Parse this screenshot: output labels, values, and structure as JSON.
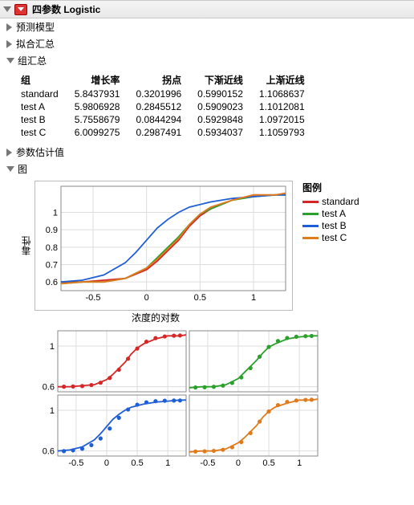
{
  "main_title": "四参数 Logistic",
  "sections": {
    "predict_model": "预测模型",
    "fit_summary": "拟合汇总",
    "group_summary": "组汇总",
    "param_est": "参数估计值",
    "chart": "图"
  },
  "table": {
    "headers": [
      "组",
      "增长率",
      "拐点",
      "下渐近线",
      "上渐近线"
    ],
    "rows": [
      [
        "standard",
        "5.8437931",
        "0.3201996",
        "0.5990152",
        "1.1068637"
      ],
      [
        "test A",
        "5.9806928",
        "0.2845512",
        "0.5909023",
        "1.1012081"
      ],
      [
        "test B",
        "5.7558679",
        "0.0844294",
        "0.5929848",
        "1.0972015"
      ],
      [
        "test C",
        "6.0099275",
        "0.2987491",
        "0.5934037",
        "1.1059793"
      ]
    ]
  },
  "legend_title": "图例",
  "series_colors": {
    "standard": "#d62728",
    "test A": "#2ca02c",
    "test B": "#1f5fd6",
    "test C": "#e07b1c"
  },
  "series_order": [
    "standard",
    "test A",
    "test B",
    "test C"
  ],
  "y_axis_label": "毒性",
  "x_axis_label": "浓度的对数",
  "chart_data": {
    "type": "line",
    "title": "",
    "xlabel": "浓度的对数",
    "ylabel": "毒性",
    "xlim": [
      -0.8,
      1.3
    ],
    "ylim": [
      0.55,
      1.15
    ],
    "xticks": [
      -0.5,
      0,
      0.5,
      1
    ],
    "yticks": [
      0.6,
      0.7,
      0.8,
      0.9,
      1
    ],
    "series": [
      {
        "name": "standard",
        "color": "#d62728",
        "x": [
          -0.8,
          -0.6,
          -0.4,
          -0.2,
          0.0,
          0.1,
          0.2,
          0.3,
          0.4,
          0.5,
          0.6,
          0.8,
          1.0,
          1.2,
          1.3
        ],
        "y": [
          0.6,
          0.6,
          0.61,
          0.62,
          0.67,
          0.72,
          0.78,
          0.84,
          0.92,
          0.98,
          1.02,
          1.07,
          1.1,
          1.1,
          1.11
        ]
      },
      {
        "name": "test A",
        "color": "#2ca02c",
        "x": [
          -0.8,
          -0.6,
          -0.4,
          -0.2,
          0.0,
          0.1,
          0.2,
          0.3,
          0.4,
          0.5,
          0.6,
          0.8,
          1.0,
          1.2,
          1.3
        ],
        "y": [
          0.59,
          0.6,
          0.6,
          0.62,
          0.68,
          0.74,
          0.8,
          0.86,
          0.93,
          0.99,
          1.02,
          1.07,
          1.09,
          1.1,
          1.1
        ]
      },
      {
        "name": "test B",
        "color": "#1f5fd6",
        "x": [
          -0.8,
          -0.6,
          -0.4,
          -0.2,
          -0.1,
          0.0,
          0.1,
          0.2,
          0.3,
          0.4,
          0.6,
          0.8,
          1.0,
          1.2,
          1.3
        ],
        "y": [
          0.6,
          0.61,
          0.64,
          0.71,
          0.77,
          0.84,
          0.91,
          0.96,
          1.0,
          1.03,
          1.06,
          1.08,
          1.09,
          1.1,
          1.1
        ]
      },
      {
        "name": "test C",
        "color": "#e07b1c",
        "x": [
          -0.8,
          -0.6,
          -0.4,
          -0.2,
          0.0,
          0.1,
          0.2,
          0.3,
          0.4,
          0.5,
          0.6,
          0.8,
          1.0,
          1.2,
          1.3
        ],
        "y": [
          0.59,
          0.6,
          0.6,
          0.62,
          0.68,
          0.73,
          0.79,
          0.85,
          0.93,
          0.99,
          1.03,
          1.07,
          1.1,
          1.1,
          1.11
        ]
      }
    ],
    "small_scatter_x": [
      -0.7,
      -0.55,
      -0.4,
      -0.25,
      -0.1,
      0.05,
      0.2,
      0.35,
      0.5,
      0.65,
      0.8,
      0.95,
      1.1,
      1.2
    ]
  }
}
